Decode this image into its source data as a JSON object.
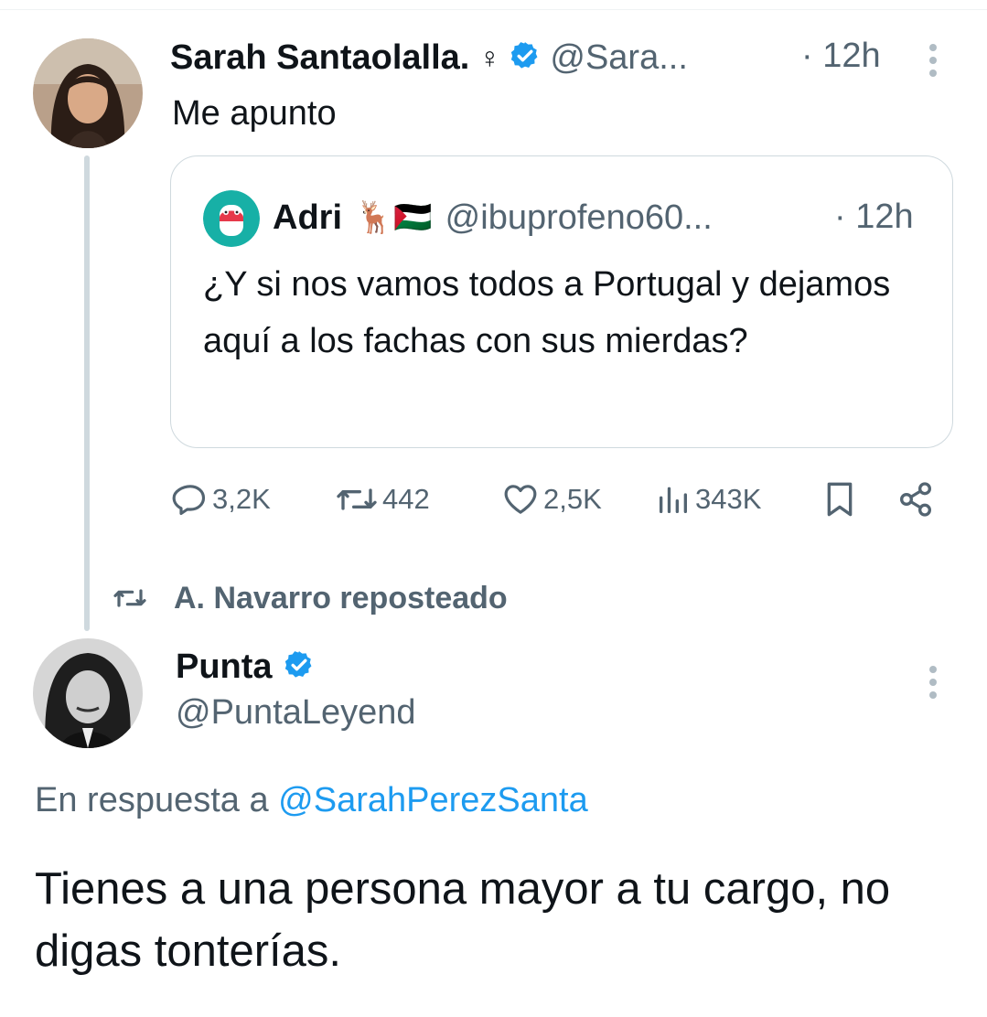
{
  "tweet1": {
    "author_name": "Sarah Santaolalla.",
    "name_suffix": "♀",
    "handle": "@Sara...",
    "time": "· 12h",
    "text": "Me apunto",
    "verified": true
  },
  "quote": {
    "author_name": "Adri",
    "emojis": "🦌🇵🇸",
    "handle": "@ibuprofeno60...",
    "time": "· 12h",
    "text": "¿Y si nos vamos todos a Portugal y dejamos aquí a los fachas con sus mierdas?"
  },
  "actions": {
    "replies": "3,2K",
    "reposts": "442",
    "likes": "2,5K",
    "views": "343K"
  },
  "repost_bar": {
    "text": "A. Navarro reposteado"
  },
  "tweet2": {
    "author_name": "Punta",
    "handle": "@PuntaLeyend",
    "verified": true,
    "reply_prefix": "En respuesta a",
    "reply_to": "@SarahPerezSanta",
    "text": "Tienes a una persona mayor a tu cargo, no digas tonterías."
  },
  "colors": {
    "verified": "#1d9bf0",
    "link": "#1d9bf0",
    "muted": "#536471",
    "border": "#cfd9de"
  }
}
